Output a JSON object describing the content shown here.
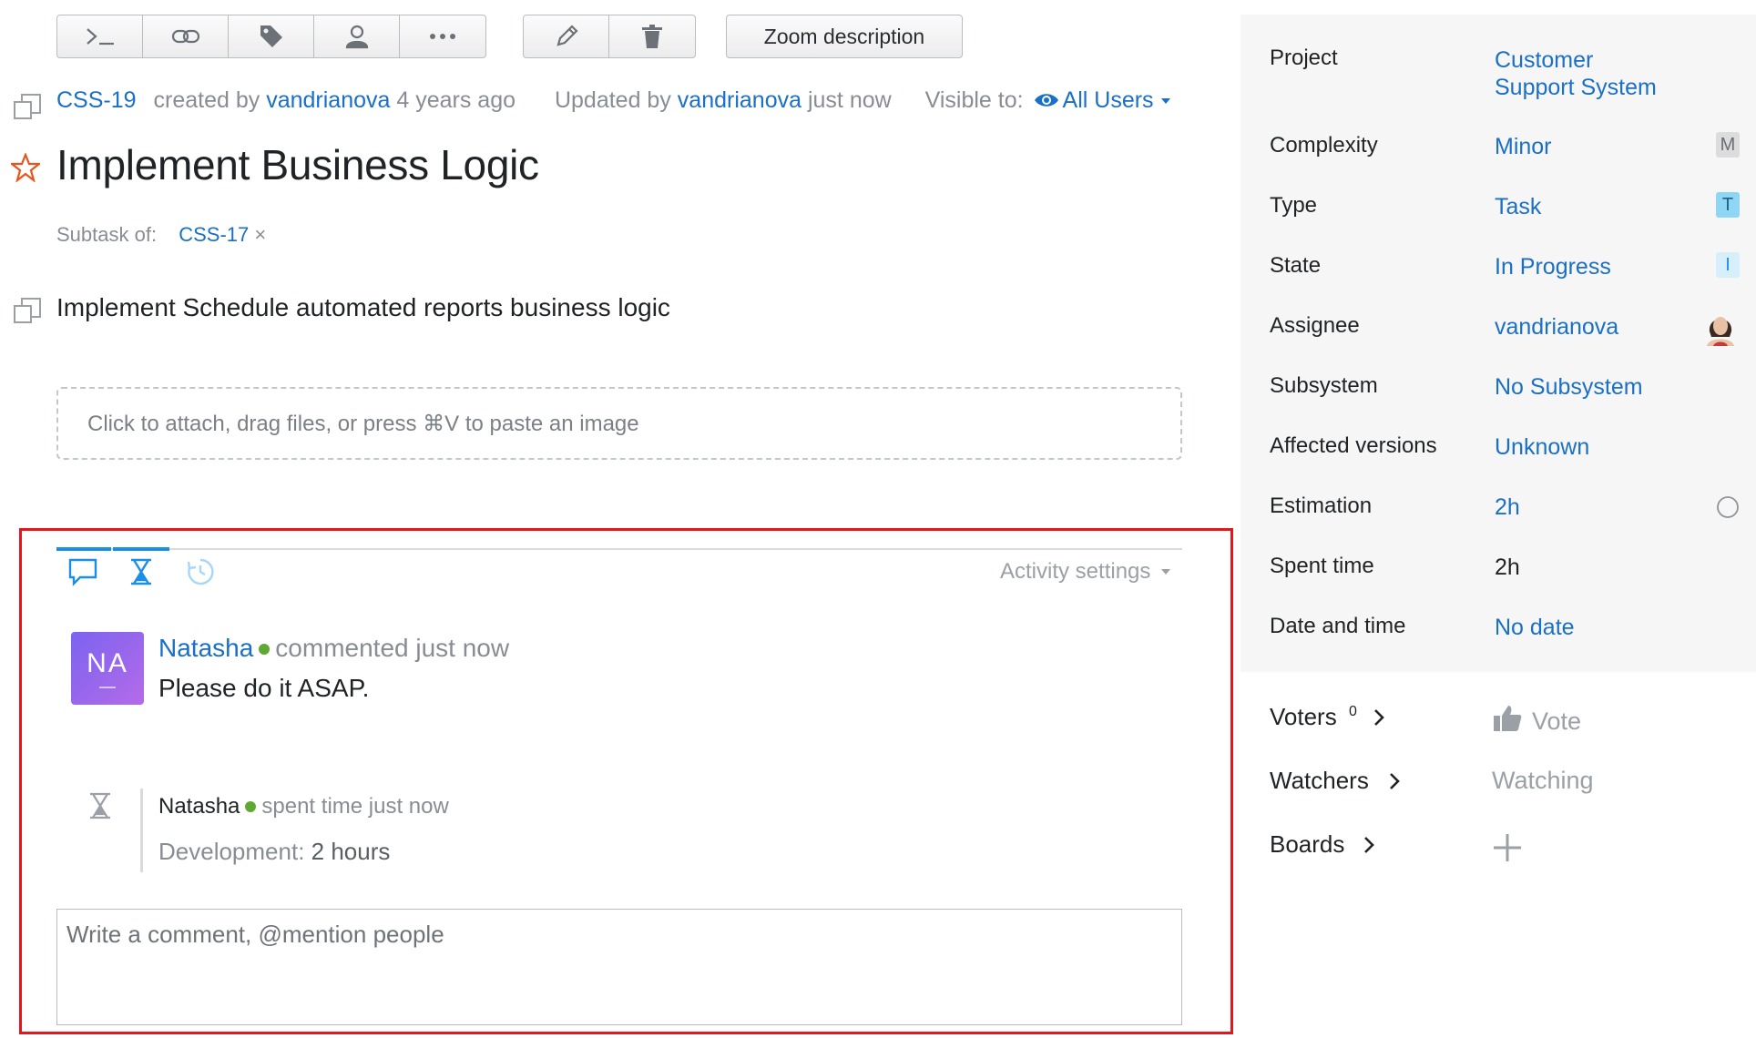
{
  "toolbar": {
    "group1_icons": [
      "command-icon",
      "link-icon",
      "tag-icon",
      "person-icon",
      "more-icon"
    ],
    "group2_icons": [
      "edit-icon",
      "delete-icon"
    ],
    "zoom_label": "Zoom description"
  },
  "issue": {
    "id": "CSS-19",
    "created_prefix": "created by",
    "creator": "vandrianova",
    "created_time": "4 years ago",
    "updated_prefix": "Updated by",
    "updater": "vandrianova",
    "updated_time": "just now",
    "visible_label": "Visible to:",
    "visible_value": "All Users",
    "title": "Implement Business Logic",
    "subtask_label": "Subtask of:",
    "subtask_parent": "CSS-17",
    "subtask_remove": "×",
    "description": "Implement Schedule automated reports business logic",
    "attach_placeholder": "Click to attach, drag files, or press ⌘V to paste an image"
  },
  "activity": {
    "settings_label": "Activity settings",
    "comment": {
      "avatar_initials": "NA",
      "author": "Natasha",
      "action": "commented just now",
      "text": "Please do it ASAP."
    },
    "timelog": {
      "author": "Natasha",
      "action": "spent time just now",
      "work_type": "Development:",
      "duration": "2 hours"
    },
    "comment_placeholder": "Write a comment, @mention people"
  },
  "fields": [
    {
      "label": "Project",
      "value": "Customer Support System",
      "value_line1": "Customer",
      "value_line2": "Support System"
    },
    {
      "label": "Complexity",
      "value": "Minor",
      "badge": "M"
    },
    {
      "label": "Type",
      "value": "Task",
      "badge": "T"
    },
    {
      "label": "State",
      "value": "In Progress",
      "badge": "I"
    },
    {
      "label": "Assignee",
      "value": "vandrianova"
    },
    {
      "label": "Subsystem",
      "value": "No Subsystem"
    },
    {
      "label": "Affected versions",
      "value": "Unknown"
    },
    {
      "label": "Estimation",
      "value": "2h"
    },
    {
      "label": "Spent time",
      "value": "2h"
    },
    {
      "label": "Date and time",
      "value": "No date"
    }
  ],
  "bottom": {
    "voters_label": "Voters",
    "voters_count": "0",
    "vote_label": "Vote",
    "watchers_label": "Watchers",
    "watching_label": "Watching",
    "boards_label": "Boards"
  },
  "colors": {
    "link": "#1a6fc6",
    "accent_blue": "#1a8fe6",
    "star": "#e8541c",
    "online": "#5fa832",
    "highlight_border": "#e8141c",
    "badge_minor": "#dcdcdc",
    "badge_task": "#8fd6f5",
    "badge_progress": "#d6effb"
  }
}
